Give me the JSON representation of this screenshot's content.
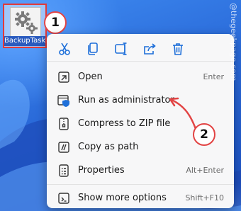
{
  "desktop": {
    "file": {
      "label": "BackupTask..."
    }
  },
  "badges": {
    "step1": "1",
    "step2": "2"
  },
  "toolbar": {
    "buttons": [
      {
        "name": "cut-icon"
      },
      {
        "name": "copy-icon"
      },
      {
        "name": "rename-icon"
      },
      {
        "name": "share-icon"
      },
      {
        "name": "delete-icon"
      }
    ]
  },
  "menu": {
    "items": [
      {
        "label": "Open",
        "shortcut": "Enter",
        "icon": "open-icon"
      },
      {
        "label": "Run as administrator",
        "shortcut": "",
        "icon": "shield-window-icon"
      },
      {
        "label": "Compress to ZIP file",
        "shortcut": "",
        "icon": "zip-icon"
      },
      {
        "label": "Copy as path",
        "shortcut": "",
        "icon": "copy-path-icon"
      },
      {
        "label": "Properties",
        "shortcut": "Alt+Enter",
        "icon": "properties-icon"
      },
      {
        "label": "Show more options",
        "shortcut": "Shift+F10",
        "icon": "more-options-icon"
      }
    ]
  },
  "watermark": "@thegeekpage.com",
  "colors": {
    "accent": "#e24444",
    "menu_bg": "#f7f7f8",
    "icon_blue": "#1e6fd9"
  }
}
